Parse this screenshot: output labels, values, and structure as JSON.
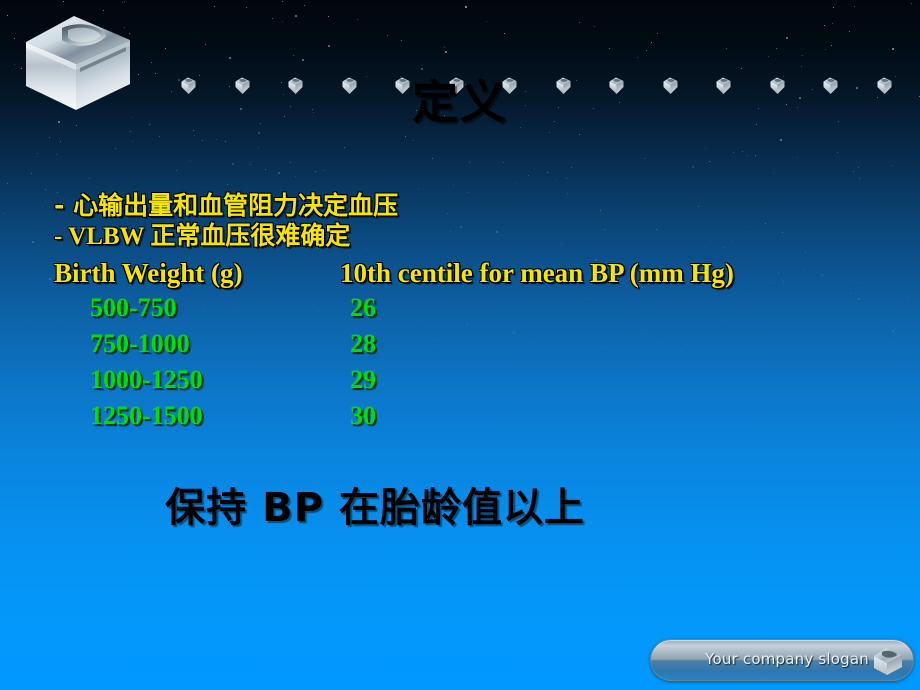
{
  "slide": {
    "title": "定义",
    "logo_icon": "chrome-cube-logo",
    "decor_icon": "silver-gem-icon",
    "decor_icon_count": 14
  },
  "bullets": [
    {
      "marker": "-",
      "text": "心输出量和血管阻力决定血压"
    },
    {
      "marker": "-",
      "text": "VLBW 正常血压很难确定"
    }
  ],
  "table": {
    "headers": [
      "Birth Weight (g)",
      "10th centile for mean BP (mm Hg)"
    ],
    "rows": [
      [
        "500-750",
        "26"
      ],
      [
        "750-1000",
        "28"
      ],
      [
        "1000-1250",
        "29"
      ],
      [
        "1250-1500",
        "30"
      ]
    ]
  },
  "headline": "保持 BP 在胎龄值以上",
  "footer": {
    "slogan": "Your company slogan",
    "icon": "cube-icon"
  },
  "colors": {
    "title_text": "#000000",
    "bullet_text": "#f5e500",
    "header_text": "#f5e500",
    "data_text": "#00e000",
    "headline_text": "#000000",
    "slogan_text": "#e9f1f7",
    "bg_top": "#01070d",
    "bg_bottom": "#0099ff"
  }
}
